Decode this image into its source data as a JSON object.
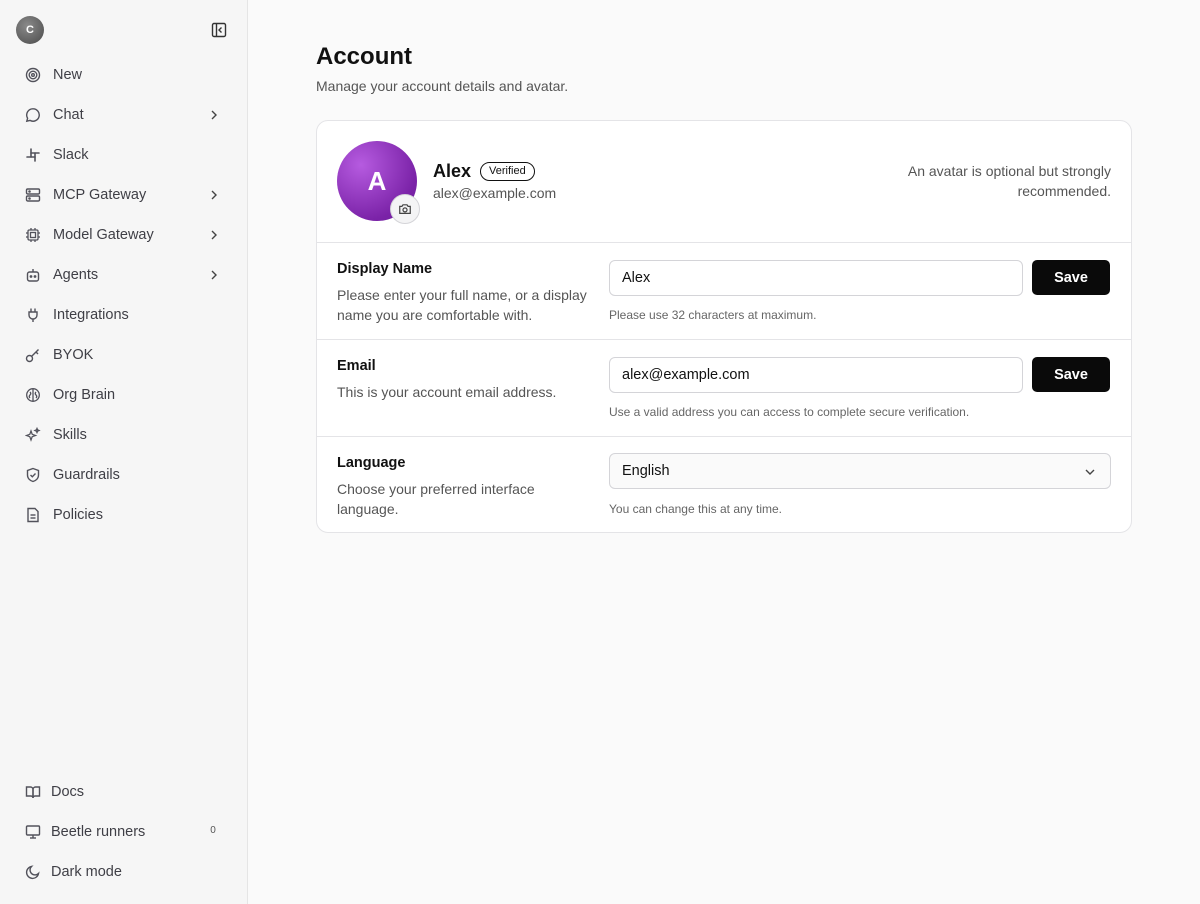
{
  "sidebar": {
    "org_initial": "C",
    "items": [
      {
        "label": "New",
        "icon": "target-icon"
      },
      {
        "label": "Chat",
        "icon": "chat-bubble-icon",
        "has_submenu": true
      },
      {
        "label": "Slack",
        "icon": "slack-icon"
      },
      {
        "label": "MCP Gateway",
        "icon": "server-icon",
        "has_submenu": true
      },
      {
        "label": "Model Gateway",
        "icon": "cpu-icon",
        "has_submenu": true
      },
      {
        "label": "Agents",
        "icon": "bot-icon",
        "has_submenu": true
      },
      {
        "label": "Integrations",
        "icon": "plug-icon"
      },
      {
        "label": "BYOK",
        "icon": "key-icon"
      },
      {
        "label": "Org Brain",
        "icon": "brain-icon"
      },
      {
        "label": "Skills",
        "icon": "sparkles-icon"
      },
      {
        "label": "Guardrails",
        "icon": "shield-icon"
      },
      {
        "label": "Policies",
        "icon": "document-icon"
      }
    ],
    "bottom": [
      {
        "label": "Docs",
        "icon": "book-icon"
      },
      {
        "label": "Beetle runners",
        "icon": "monitor-icon",
        "count": "0"
      },
      {
        "label": "Dark mode",
        "icon": "moon-icon"
      }
    ]
  },
  "page": {
    "title": "Account",
    "subtitle": "Manage your account details and avatar."
  },
  "profile": {
    "initial": "A",
    "name": "Alex",
    "badge": "Verified",
    "email": "alex@example.com",
    "avatar_note": "An avatar is optional but strongly recommended.",
    "avatar_color": "#8e2fc4"
  },
  "display_name": {
    "label": "Display Name",
    "description": "Please enter your full name, or a display name you are comfortable with.",
    "value": "Alex",
    "button": "Save",
    "hint": "Please use 32 characters at maximum."
  },
  "email": {
    "label": "Email",
    "description": "This is your account email address.",
    "value": "alex@example.com",
    "button": "Save",
    "hint": "Use a valid address you can access to complete secure verification."
  },
  "language": {
    "label": "Language",
    "description": "Choose your preferred interface language.",
    "value": "English",
    "hint": "You can change this at any time."
  }
}
